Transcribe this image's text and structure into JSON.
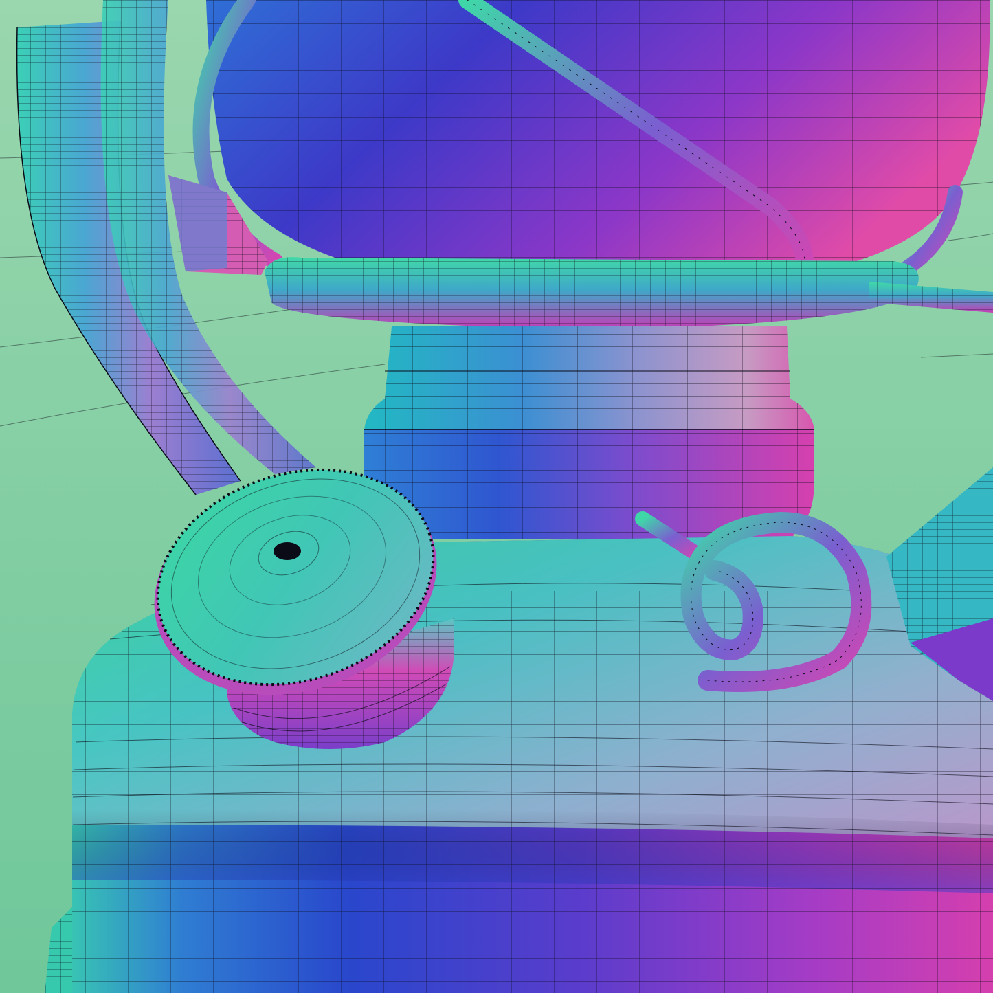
{
  "scene": {
    "subject": "oil-lantern-normal-map-wireframe",
    "colors": {
      "background_top": "#8fd3a4",
      "background_bottom": "#72c99a",
      "normal_blue": "#2a4fcf",
      "normal_violet": "#7a35c9",
      "normal_magenta": "#d23aa6",
      "normal_teal": "#2fc6b2",
      "normal_green": "#3fd39a",
      "wire": "#0b0b18"
    },
    "icons": [
      "lantern-handle-icon",
      "filler-cap-icon",
      "wick-key-icon"
    ]
  }
}
